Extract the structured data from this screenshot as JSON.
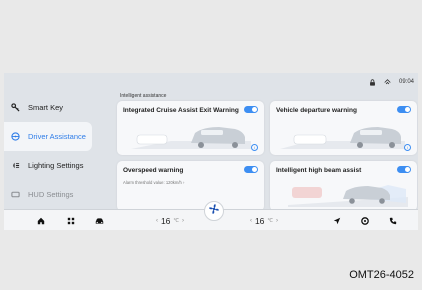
{
  "status_bar": {
    "time": "09:04",
    "icons": [
      "lock-icon",
      "signal-icon"
    ]
  },
  "sidebar": {
    "items": [
      {
        "label": "Smart Key",
        "icon": "key-icon",
        "active": false
      },
      {
        "label": "Driver Assistance",
        "icon": "steering-wheel-icon",
        "active": true
      },
      {
        "label": "Lighting Settings",
        "icon": "headlight-icon",
        "active": false
      },
      {
        "label": "HUD Settings",
        "icon": "hud-icon",
        "active": false
      }
    ]
  },
  "main": {
    "section_label": "Intelligent assistance",
    "cards": [
      {
        "title": "Integrated Cruise Assist Exit Warning",
        "toggle_on": true,
        "has_info": true
      },
      {
        "title": "Vehicle departure warning",
        "toggle_on": true,
        "has_info": true
      },
      {
        "title": "Overspeed warning",
        "subtitle": "Alarm threshold value: 120km/h ›",
        "toggle_on": true
      },
      {
        "title": "Intelligent high beam assist",
        "toggle_on": true
      }
    ]
  },
  "bottom_bar": {
    "left_temp": "16",
    "right_temp": "16",
    "temp_unit": "℃",
    "icons": [
      "home-icon",
      "apps-icon",
      "car-icon",
      "fan-icon",
      "navigation-icon",
      "media-icon",
      "phone-icon"
    ]
  },
  "caption": "OMT26-4052",
  "colors": {
    "accent": "#3d8ef2",
    "screen_bg": "#dfe3e8",
    "card_bg": "#f7f8fa"
  }
}
